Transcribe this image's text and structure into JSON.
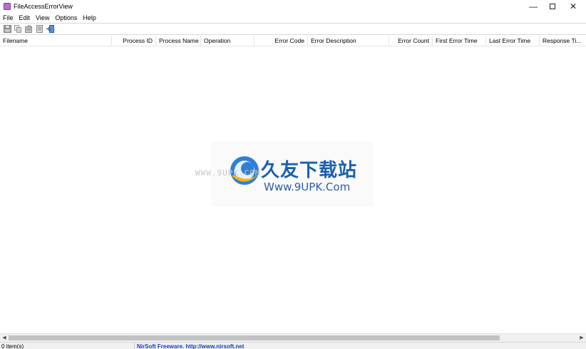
{
  "window": {
    "title": "FileAccessErrorView",
    "minimize_glyph": "—",
    "close_glyph": "✕"
  },
  "menu": {
    "items": [
      "File",
      "Edit",
      "View",
      "Options",
      "Help"
    ]
  },
  "toolbar": {
    "buttons": [
      "save-icon",
      "copy-icon",
      "properties-icon",
      "html-report-icon",
      "exit-icon"
    ]
  },
  "list": {
    "columns": [
      {
        "label": "Filename"
      },
      {
        "label": "Process ID"
      },
      {
        "label": "Process Name"
      },
      {
        "label": "Operation"
      },
      {
        "label": "Error Code"
      },
      {
        "label": "Error Description"
      },
      {
        "label": "Error Count"
      },
      {
        "label": "First Error Time"
      },
      {
        "label": "Last Error Time"
      },
      {
        "label": "Response Ti..."
      }
    ]
  },
  "watermark": {
    "www": "WWW.9UPK.COM",
    "cn_text": "久友下载站",
    "url": "Www.9UPK.Com"
  },
  "statusbar": {
    "count": "0 item(s)",
    "link": "NirSoft Freeware.  http://www.nirsoft.net"
  }
}
